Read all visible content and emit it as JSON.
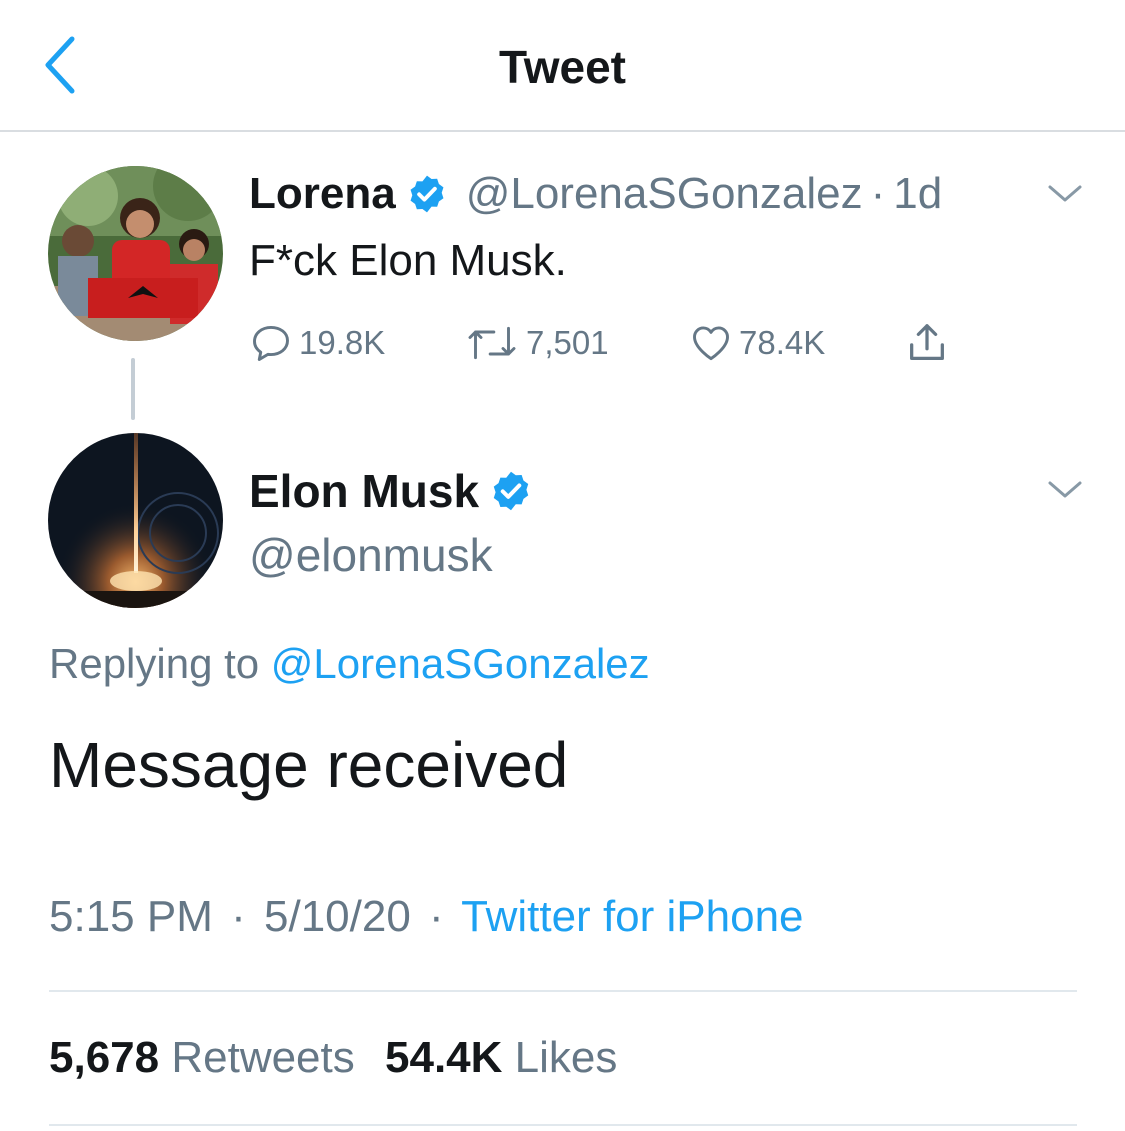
{
  "header": {
    "title": "Tweet",
    "back_icon": "chevron-left-icon"
  },
  "colors": {
    "accent": "#1da1f2",
    "secondary_text": "#657786",
    "primary_text": "#14171a"
  },
  "parent_tweet": {
    "display_name": "Lorena",
    "verified": true,
    "handle": "@LorenaSGonzalez",
    "separator": "·",
    "time_ago": "1d",
    "text": "F*ck Elon Musk.",
    "actions": {
      "replies": "19.8K",
      "retweets": "7,501",
      "likes": "78.4K"
    }
  },
  "main_tweet": {
    "display_name": "Elon Musk",
    "verified": true,
    "handle": "@elonmusk",
    "replying_prefix": "Replying to",
    "replying_handle": "@LorenaSGonzalez",
    "text": "Message received",
    "time": "5:15 PM",
    "separator": "·",
    "date": "5/10/20",
    "source": "Twitter for iPhone",
    "stats": {
      "retweets_count": "5,678",
      "retweets_label": "Retweets",
      "likes_count": "54.4K",
      "likes_label": "Likes"
    }
  }
}
